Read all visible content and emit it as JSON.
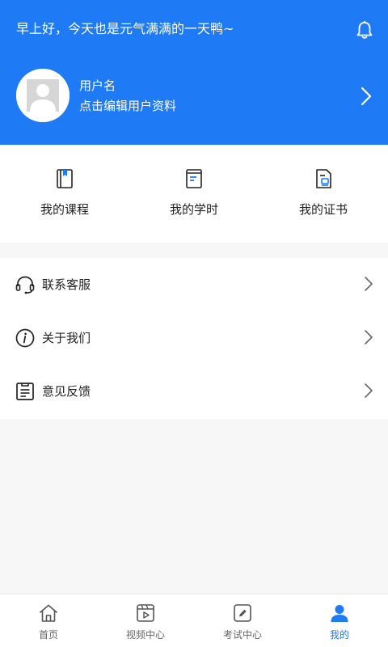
{
  "header": {
    "greeting": "早上好，今天也是元气满满的一天鸭~",
    "username": "用户名",
    "edit_hint": "点击编辑用户资料"
  },
  "quick_links": [
    {
      "label": "我的课程",
      "icon": "course-book-icon"
    },
    {
      "label": "我的学时",
      "icon": "study-hours-icon"
    },
    {
      "label": "我的证书",
      "icon": "certificate-icon"
    }
  ],
  "menu": [
    {
      "label": "联系客服",
      "icon": "headset-icon"
    },
    {
      "label": "关于我们",
      "icon": "info-icon"
    },
    {
      "label": "意见反馈",
      "icon": "feedback-icon"
    }
  ],
  "tabs": [
    {
      "label": "首页",
      "icon": "home-icon"
    },
    {
      "label": "视频中心",
      "icon": "video-icon"
    },
    {
      "label": "考试中心",
      "icon": "exam-icon"
    },
    {
      "label": "我的",
      "icon": "user-icon",
      "active": true
    }
  ],
  "colors": {
    "accent": "#1e7bf5",
    "background": "#f7f7f7",
    "text": "#222222",
    "tab_inactive": "#666666"
  }
}
